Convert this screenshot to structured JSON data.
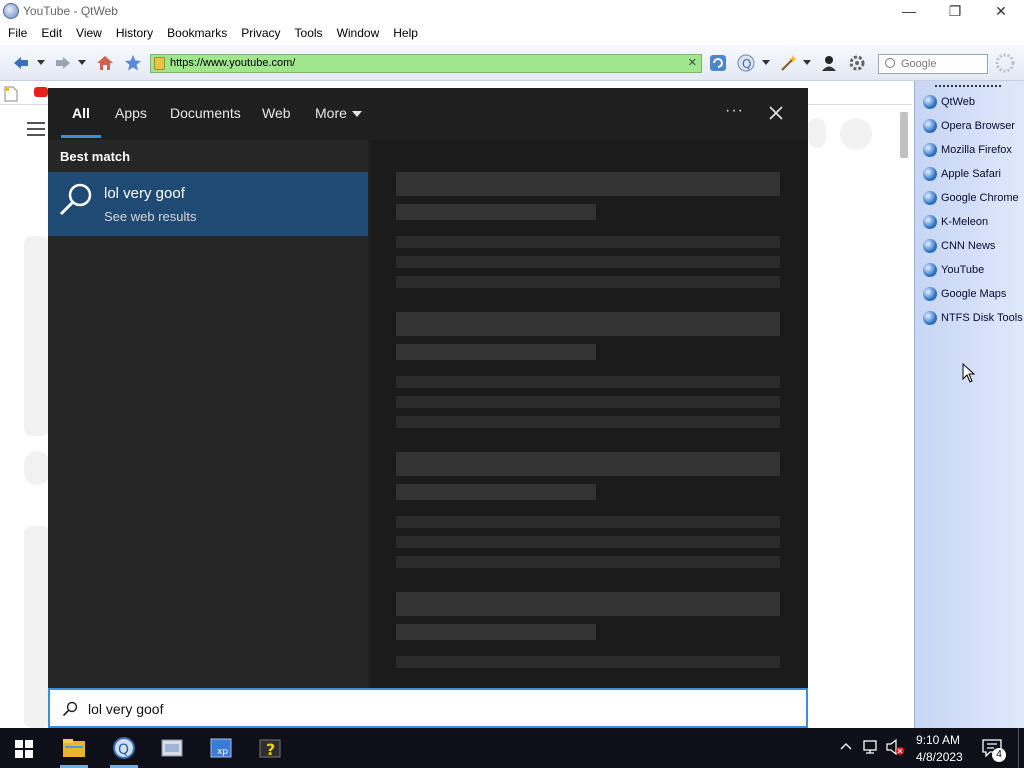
{
  "window": {
    "title": "YouTube - QtWeb",
    "minimize": "—",
    "maximize": "❐",
    "close": "✕"
  },
  "menu": [
    "File",
    "Edit",
    "View",
    "History",
    "Bookmarks",
    "Privacy",
    "Tools",
    "Window",
    "Help"
  ],
  "toolbar": {
    "url": "https://www.youtube.com/",
    "search_placeholder": "Google"
  },
  "sidebar": {
    "items": [
      "QtWeb",
      "Opera Browser",
      "Mozilla Firefox",
      "Apple Safari",
      "Google Chrome",
      "K-Meleon",
      "CNN News",
      "YouTube",
      "Google Maps",
      "NTFS Disk Tools"
    ]
  },
  "search_panel": {
    "tabs": [
      "All",
      "Apps",
      "Documents",
      "Web",
      "More"
    ],
    "more_icon": "ellipsis-icon",
    "close_icon": "close-icon",
    "best_match_heading": "Best match",
    "best_match": {
      "title": "lol very goof",
      "subtitle": "See web results"
    },
    "query": "lol very goof"
  },
  "taskbar": {
    "time": "9:10 AM",
    "date": "4/8/2023",
    "notification_count": "4"
  }
}
